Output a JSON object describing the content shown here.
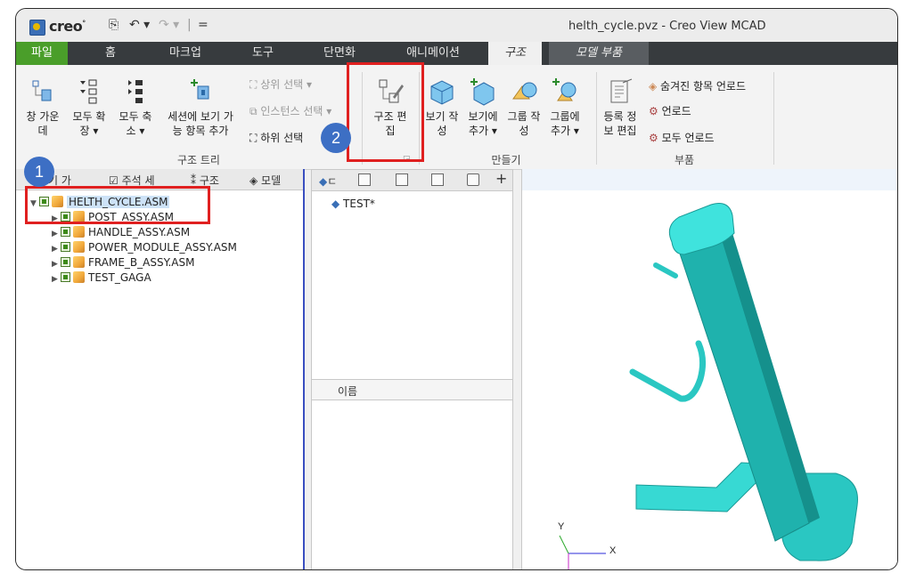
{
  "titlebar": {
    "logo": "creo",
    "logo_mark": "°",
    "quick_access": [
      "⎘",
      "↶ ▾",
      "↷ ▾",
      "|",
      "="
    ],
    "window_title": "helth_cycle.pvz - Creo View MCAD"
  },
  "tabs": [
    {
      "label": "파일"
    },
    {
      "label": "홈"
    },
    {
      "label": "마크업"
    },
    {
      "label": "도구"
    },
    {
      "label": "단면화"
    },
    {
      "label": "애니메이션"
    },
    {
      "label": "구조"
    },
    {
      "label": "모델 부품"
    }
  ],
  "ribbon": {
    "group_tree": "구조 트리",
    "group_create": "만들기",
    "group_parts": "부품",
    "buttons": {
      "fit_window": [
        "창 가운",
        "데"
      ],
      "expand_all": [
        "모두 확",
        "장 ▾"
      ],
      "collapse_all": [
        "모두 축",
        "소 ▾"
      ],
      "add_session": [
        "세션에 보기 가",
        "능 항목 추가"
      ],
      "select_parent": "상위 선택 ▾",
      "select_instance": "인스턴스 선택 ▾",
      "select_child": "하위 선택",
      "edit_structure": [
        "구조 편",
        "집"
      ],
      "create_view": [
        "보기 작",
        "성"
      ],
      "add_view": [
        "보기에",
        "추가 ▾"
      ],
      "create_group": [
        "그룹 작",
        "성"
      ],
      "add_group": [
        "그룹에",
        "추가 ▾"
      ],
      "edit_registration": [
        "등록 정",
        "보 편집"
      ],
      "unload_hidden": "숨겨진 항목 언로드",
      "unload": "언로드",
      "unload_all": "모두 언로드"
    }
  },
  "left_panel": {
    "tabs": [
      "기 가",
      "주석 세",
      "구조",
      "모델"
    ],
    "tree": [
      {
        "label": "HELTH_CYCLE.ASM",
        "level": 0,
        "expanded": true,
        "selected": true
      },
      {
        "label": "POST_ASSY.ASM",
        "level": 1
      },
      {
        "label": "HANDLE_ASSY.ASM",
        "level": 1
      },
      {
        "label": "POWER_MODULE_ASSY.ASM",
        "level": 1
      },
      {
        "label": "FRAME_B_ASSY.ASM",
        "level": 1
      },
      {
        "label": "TEST_GAGA",
        "level": 1
      }
    ]
  },
  "mid_panel": {
    "first_tab": "ㄷ",
    "add_tab": "+",
    "item": "TEST*",
    "name_header": "이름"
  },
  "viewport": {
    "axis_y": "Y",
    "axis_x": "X",
    "model_color": "#2ad0cc"
  },
  "callouts": {
    "one": "1",
    "two": "2"
  }
}
